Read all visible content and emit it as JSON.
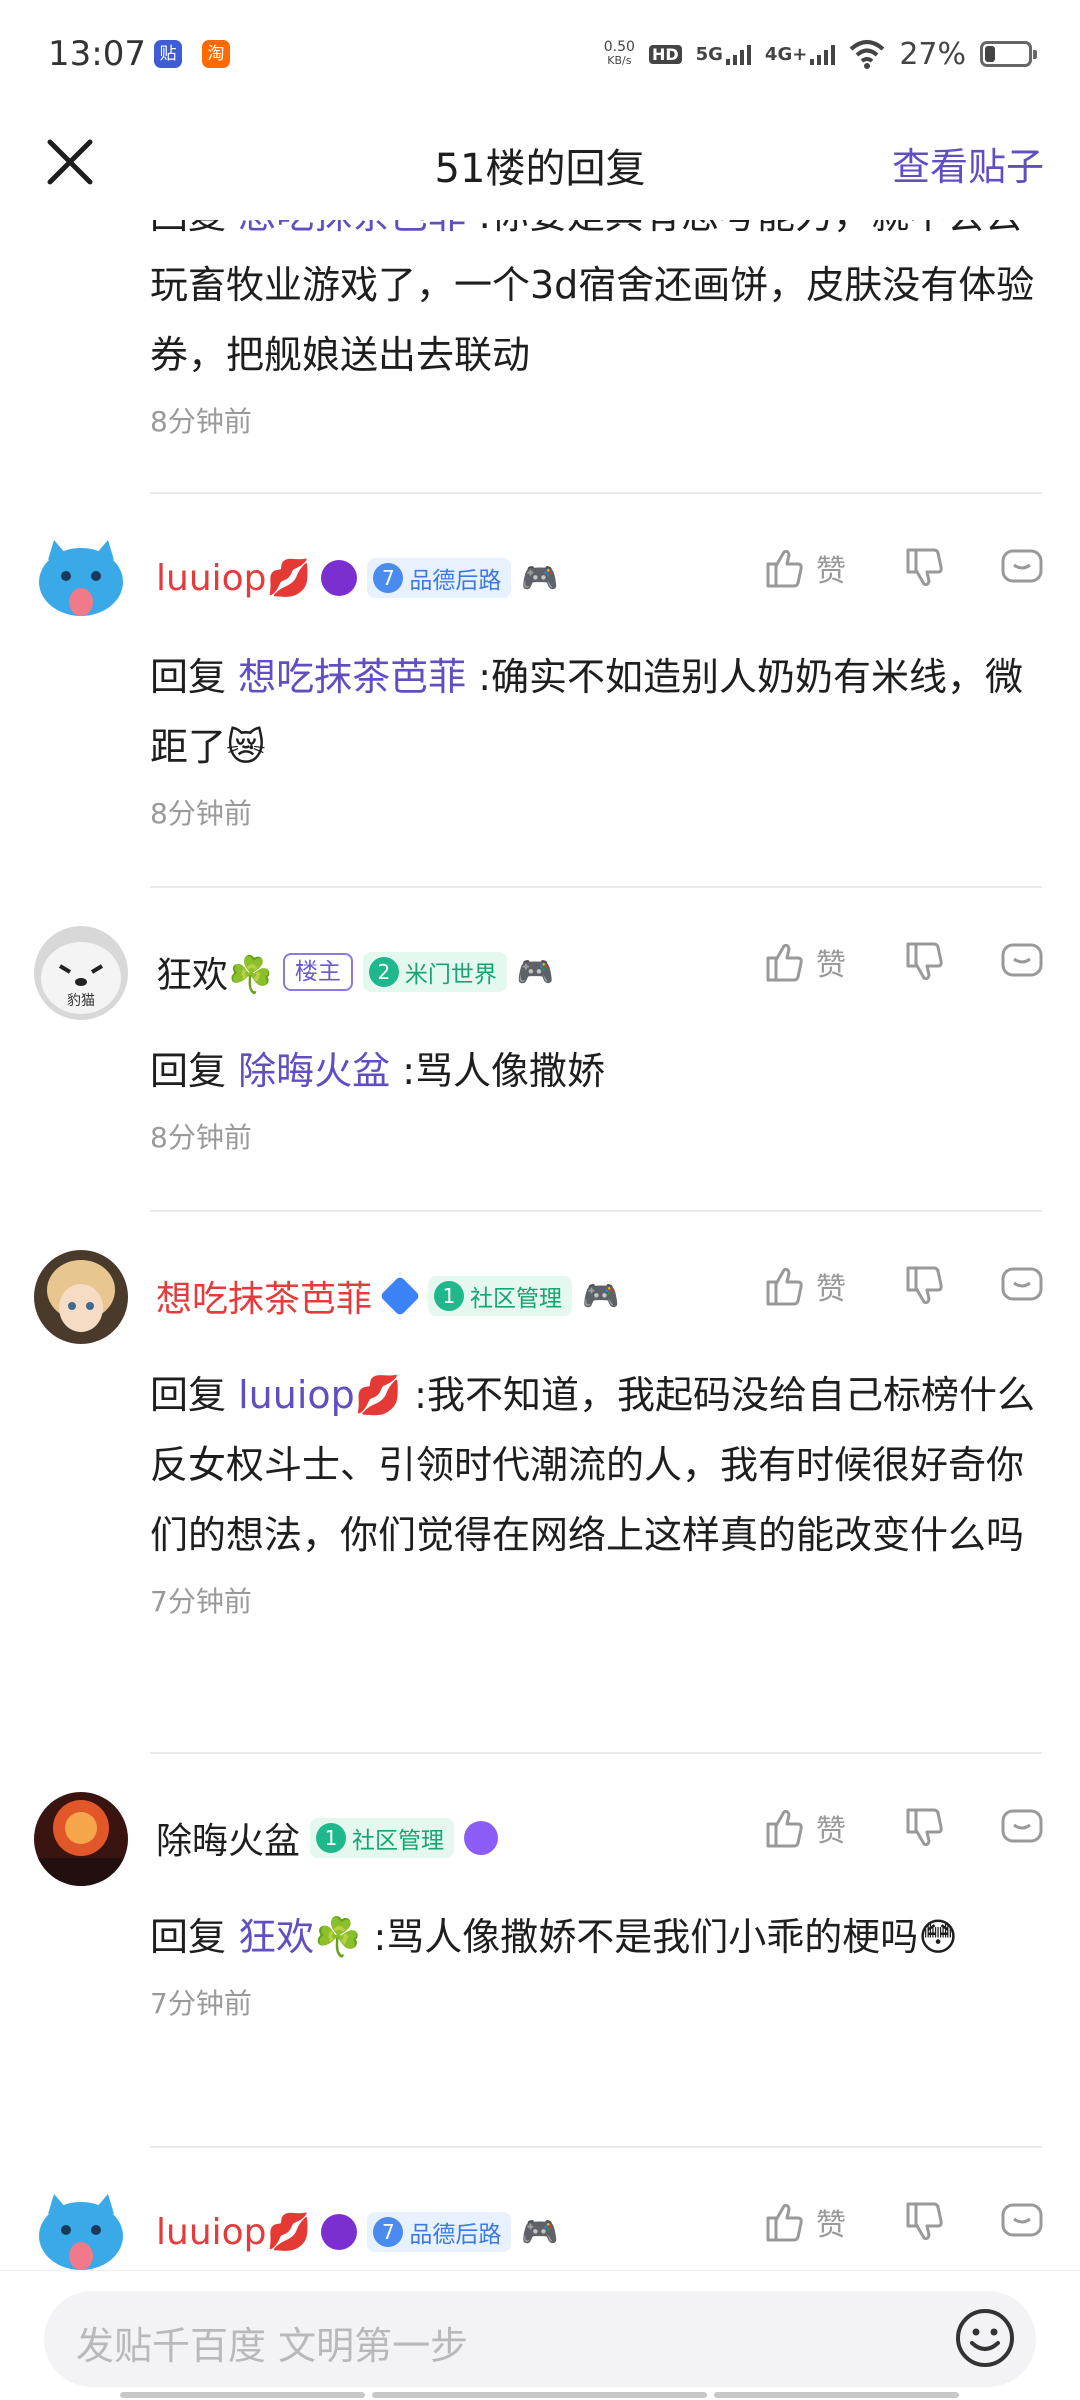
{
  "status_bar": {
    "time": "13:07",
    "app_icons": [
      "贴",
      "淘"
    ],
    "net_speed_top": "0.50",
    "net_speed_bottom": "KB/s",
    "hd_tag": "HD",
    "sim1": "5G",
    "sim2": "4G+",
    "battery": "27%"
  },
  "header": {
    "title": "51楼的回复",
    "view_post": "查看贴子"
  },
  "partial_comment": {
    "text": "回复 想吃抹茶芭菲 :你要是具有思考能力，就不会去玩畜牧业游戏了，一个3d宿舍还画饼，皮肤没有体验券，把舰娘送出去联动",
    "prefix": "回复 ",
    "mention": "想吃抹茶芭菲",
    "body": " :你要是具有思考能力，就不会去玩畜牧业游戏了，一个3d宿舍还画饼，皮肤没有体验券，把舰娘送出去联动",
    "time": "8分钟前"
  },
  "like_label": "赞",
  "comments": [
    {
      "name": "luuiop💋",
      "level": "7",
      "badge": "品德后路",
      "emoji": "👑",
      "prefix": "回复 ",
      "mention": "想吃抹茶芭菲",
      "body": " :确实不如造别人奶奶有米线，微距了😿",
      "time": "8分钟前"
    },
    {
      "name": "狂欢☘️",
      "host_tag": "楼主",
      "level": "2",
      "badge": "米门世界",
      "avatar_text": "豹猫",
      "prefix": "回复 ",
      "mention": "除晦火盆",
      "body": " :骂人像撒娇",
      "time": "8分钟前"
    },
    {
      "name": "想吃抹茶芭菲",
      "level": "1",
      "badge": "社区管理",
      "prefix": "回复 ",
      "mention": "luuiop💋",
      "body": " :我不知道，我起码没给自己标榜什么反女权斗士、引领时代潮流的人，我有时候很好奇你们的想法，你们觉得在网络上这样真的能改变什么吗",
      "time": "7分钟前"
    },
    {
      "name": "除晦火盆",
      "level": "1",
      "badge": "社区管理",
      "prefix": "回复 ",
      "mention": "狂欢☘️",
      "body": " :骂人像撒娇不是我们小乖的梗吗😳",
      "time": "7分钟前"
    },
    {
      "name": "luuiop💋",
      "level": "7",
      "badge": "品德后路",
      "emoji": "👑"
    }
  ],
  "input": {
    "placeholder": "发贴千百度 文明第一步"
  },
  "colors": {
    "accent": "#614ec2",
    "red_name": "#e33c3c",
    "badge_blue": "#4a8bf0",
    "badge_green": "#1fb88a"
  }
}
